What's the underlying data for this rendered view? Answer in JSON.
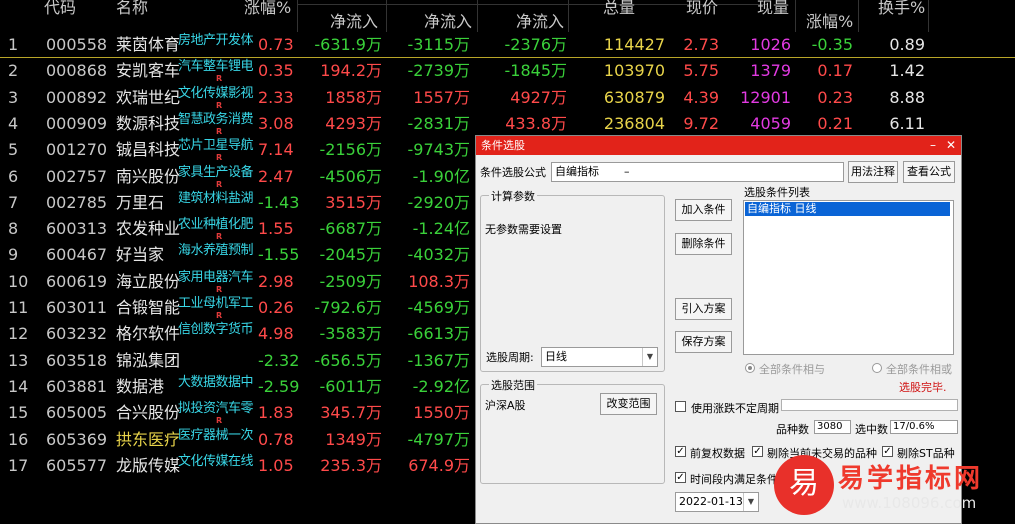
{
  "header": {
    "code": "代码",
    "name": "名称",
    "change_pct": "涨幅%",
    "net_inflow_1": "净流入",
    "net_inflow_2": "净流入",
    "net_inflow_3": "净流入",
    "volume": "总量",
    "price": "现价",
    "current_vol": "现量",
    "change_pct_2": "涨幅%",
    "turnover": "换手%"
  },
  "rows": [
    {
      "num": "1",
      "code": "000558",
      "name": "莱茵体育",
      "tag": "房地产开发体",
      "r": "",
      "pct": "0.73",
      "f1": "-631.9万",
      "f2": "-3115万",
      "f3": "-2376万",
      "vol": "114427",
      "price": "2.73",
      "cur": "1026",
      "chg": "-0.35",
      "turn": "0.89"
    },
    {
      "num": "2",
      "code": "000868",
      "name": "安凯客车",
      "tag": "汽车整车锂电",
      "r": "R",
      "pct": "0.35",
      "f1": "194.2万",
      "f2": "-2739万",
      "f3": "-1845万",
      "vol": "103970",
      "price": "5.75",
      "cur": "1379",
      "chg": "0.17",
      "turn": "1.42"
    },
    {
      "num": "3",
      "code": "000892",
      "name": "欢瑞世纪",
      "tag": "文化传媒影视",
      "r": "R",
      "pct": "2.33",
      "f1": "1858万",
      "f2": "1557万",
      "f3": "4927万",
      "vol": "630879",
      "price": "4.39",
      "cur": "12901",
      "chg": "0.23",
      "turn": "8.88"
    },
    {
      "num": "4",
      "code": "000909",
      "name": "数源科技",
      "tag": "智慧政务消费",
      "r": "R",
      "pct": "3.08",
      "f1": "4293万",
      "f2": "-2831万",
      "f3": "433.8万",
      "vol": "236804",
      "price": "9.72",
      "cur": "4059",
      "chg": "0.21",
      "turn": "6.11"
    },
    {
      "num": "5",
      "code": "001270",
      "name": "铖昌科技",
      "tag": "芯片卫星导航",
      "r": "R",
      "pct": "7.14",
      "f1": "-2156万",
      "f2": "-9743万",
      "f3": "",
      "vol": "",
      "price": "",
      "cur": "",
      "chg": "",
      "turn": ""
    },
    {
      "num": "6",
      "code": "002757",
      "name": "南兴股份",
      "tag": "家具生产设备",
      "r": "R",
      "pct": "2.47",
      "f1": "-4506万",
      "f2": "-1.90亿",
      "f3": "",
      "vol": "",
      "price": "",
      "cur": "",
      "chg": "",
      "turn": ""
    },
    {
      "num": "7",
      "code": "002785",
      "name": "万里石",
      "tag": "建筑材料盐湖",
      "r": "",
      "pct": "-1.43",
      "f1": "3515万",
      "f2": "-2920万",
      "f3": "",
      "vol": "",
      "price": "",
      "cur": "",
      "chg": "",
      "turn": ""
    },
    {
      "num": "8",
      "code": "600313",
      "name": "农发种业",
      "tag": "农业种植化肥",
      "r": "R",
      "pct": "1.55",
      "f1": "-6687万",
      "f2": "-1.24亿",
      "f3": "",
      "vol": "",
      "price": "",
      "cur": "",
      "chg": "",
      "turn": ""
    },
    {
      "num": "9",
      "code": "600467",
      "name": "好当家",
      "tag": "海水养殖预制",
      "r": "",
      "pct": "-1.55",
      "f1": "-2045万",
      "f2": "-4032万",
      "f3": "",
      "vol": "",
      "price": "",
      "cur": "",
      "chg": "",
      "turn": ""
    },
    {
      "num": "10",
      "code": "600619",
      "name": "海立股份",
      "tag": "家用电器汽车",
      "r": "R",
      "pct": "2.98",
      "f1": "-2509万",
      "f2": "108.3万",
      "f3": "",
      "vol": "",
      "price": "",
      "cur": "",
      "chg": "",
      "turn": ""
    },
    {
      "num": "11",
      "code": "603011",
      "name": "合锻智能",
      "tag": "工业母机军工",
      "r": "R",
      "pct": "0.26",
      "f1": "-792.6万",
      "f2": "-4569万",
      "f3": "",
      "vol": "",
      "price": "",
      "cur": "",
      "chg": "",
      "turn": ""
    },
    {
      "num": "12",
      "code": "603232",
      "name": "格尔软件",
      "tag": "信创数字货币",
      "r": "",
      "pct": "4.98",
      "f1": "-3583万",
      "f2": "-6613万",
      "f3": "",
      "vol": "",
      "price": "",
      "cur": "",
      "chg": "",
      "turn": ""
    },
    {
      "num": "13",
      "code": "603518",
      "name": "锦泓集团",
      "tag": "",
      "r": "",
      "pct": "-2.32",
      "f1": "-656.5万",
      "f2": "-1367万",
      "f3": "",
      "vol": "",
      "price": "",
      "cur": "",
      "chg": "",
      "turn": ""
    },
    {
      "num": "14",
      "code": "603881",
      "name": "数据港",
      "tag": "大数据数据中",
      "r": "",
      "pct": "-2.59",
      "f1": "-6011万",
      "f2": "-2.92亿",
      "f3": "",
      "vol": "",
      "price": "",
      "cur": "",
      "chg": "",
      "turn": ""
    },
    {
      "num": "15",
      "code": "605005",
      "name": "合兴股份",
      "tag": "拟投资汽车零",
      "r": "R",
      "pct": "1.83",
      "f1": "345.7万",
      "f2": "1550万",
      "f3": "",
      "vol": "",
      "price": "",
      "cur": "",
      "chg": "",
      "turn": ""
    },
    {
      "num": "16",
      "code": "605369",
      "name": "拱东医疗",
      "tag": "医疗器械一次",
      "r": "",
      "pct": "0.78",
      "f1": "1349万",
      "f2": "-4797万",
      "f3": "",
      "vol": "",
      "price": "",
      "cur": "",
      "chg": "",
      "turn": ""
    },
    {
      "num": "17",
      "code": "605577",
      "name": "龙版传媒",
      "tag": "文化传媒在线",
      "r": "",
      "pct": "1.05",
      "f1": "235.3万",
      "f2": "674.9万",
      "f3": "",
      "vol": "",
      "price": "",
      "cur": "",
      "chg": "",
      "turn": ""
    }
  ],
  "colors": {
    "up": "#ff4a4a",
    "down": "#3ad13a",
    "tag": "#38d6e6",
    "dialog_title": "#e2231a",
    "selection": "#0a64d6"
  },
  "dialog": {
    "title": "条件选股",
    "minimize": "–",
    "close": "✕",
    "formula_label": "条件选股公式",
    "formula_value": "自编指标",
    "formula_dash": "–",
    "usage_button": "用法注释",
    "view_formula_button": "查看公式",
    "calc_params_label": "计算参数",
    "no_params_text": "无参数需要设置",
    "period_label": "选股周期:",
    "period_value": "日线",
    "add_condition": "加入条件",
    "delete_condition": "删除条件",
    "import_plan": "引入方案",
    "save_plan": "保存方案",
    "list_label": "选股条件列表",
    "list_items": [
      "自编指标  日线"
    ],
    "radio_and": "全部条件相与",
    "radio_or": "全部条件相或",
    "status": "选股完毕.",
    "range_label": "选股范围",
    "range_value": "沪深A股",
    "change_range_button": "改变范围",
    "use_uncertain_period": "使用涨跌不定周期",
    "count_label": "品种数",
    "count_value": "3080",
    "selected_label": "选中数",
    "selected_value": "17/0.6%",
    "prefq": "前复权数据",
    "exclude_untraded": "剔除当前未交易的品种",
    "exclude_st": "剔除ST品种",
    "time_period_check": "时间段内满足条件",
    "date_value": "2022-01-13"
  },
  "watermark": {
    "logo_char": "易",
    "site_name": "易学指标网",
    "url": "www.108096.com"
  }
}
